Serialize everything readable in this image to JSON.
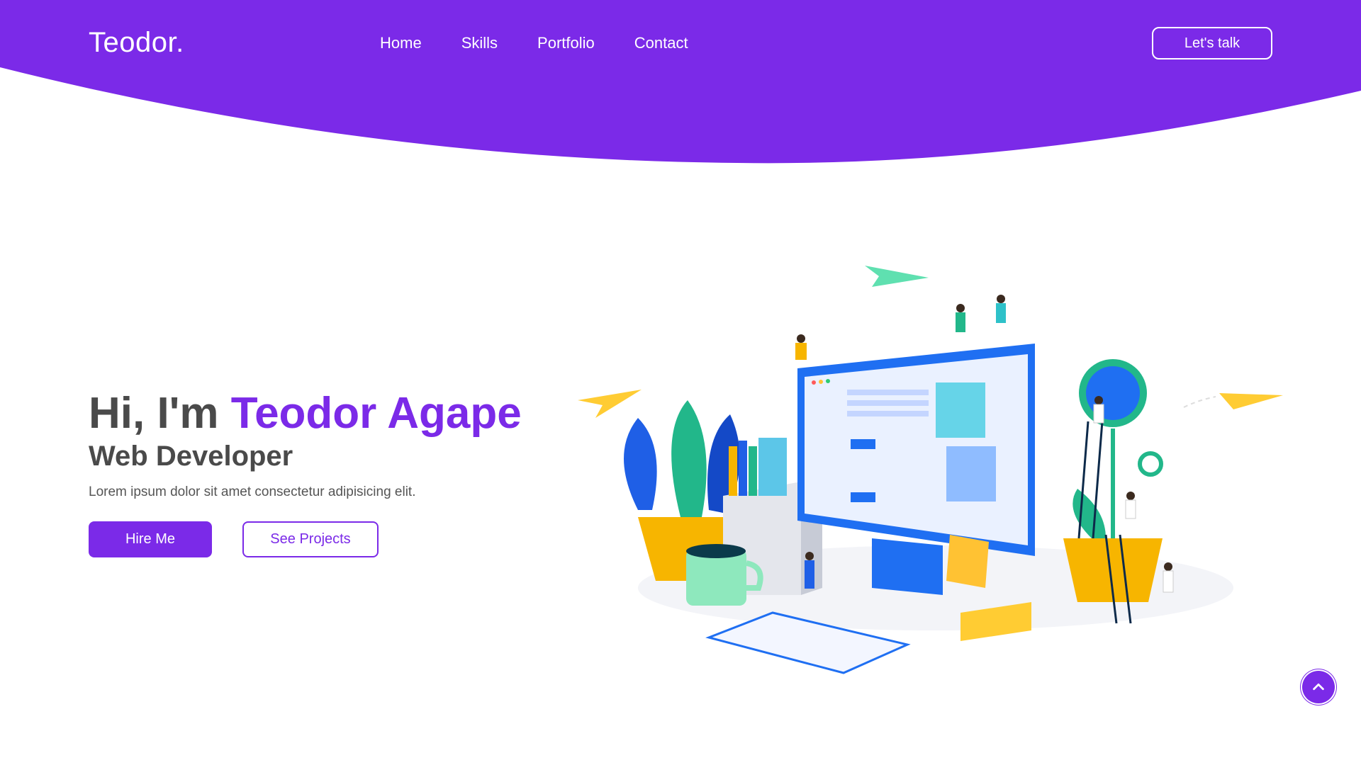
{
  "brand": {
    "logo": "Teodor."
  },
  "nav": {
    "items": [
      "Home",
      "Skills",
      "Portfolio",
      "Contact"
    ],
    "cta": "Let's talk"
  },
  "hero": {
    "greeting": "Hi, I'm",
    "name": "Teodor Agape",
    "role": "Web Developer",
    "tagline": "Lorem ipsum dolor sit amet consectetur adipisicing elit.",
    "primary_button": "Hire Me",
    "secondary_button": "See Projects"
  },
  "colors": {
    "accent": "#7b2ae8",
    "text": "#4a4a4a",
    "background": "#ffffff"
  },
  "icons": {
    "scroll_top": "chevron-up-icon"
  }
}
